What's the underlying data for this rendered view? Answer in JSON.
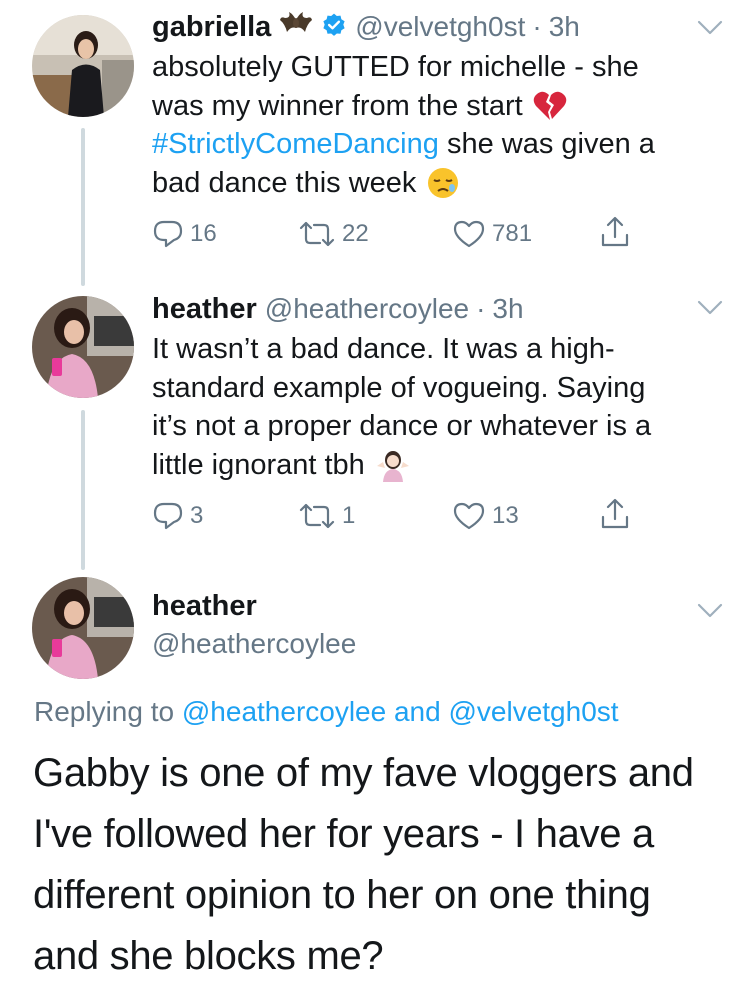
{
  "tweet1": {
    "name": "gabriella",
    "handle": "@velvetgh0st",
    "dot": "·",
    "time": "3h",
    "lines": [
      "absolutely GUTTED for michelle - she",
      "was my winner from the start",
      "#StrictlyComeDancing",
      " she was given a",
      "bad dance this week"
    ],
    "replies": "16",
    "retweets": "22",
    "likes": "781"
  },
  "tweet2": {
    "name": "heather",
    "handle": "@heathercoylee",
    "dot": "·",
    "time": "3h",
    "lines": [
      "It wasn’t a bad dance. It was a high-",
      "standard example of vogueing. Saying",
      "it’s not a proper dance or whatever is a",
      "little ignorant tbh"
    ],
    "replies": "3",
    "retweets": "1",
    "likes": "13"
  },
  "tweet3": {
    "name": "heather",
    "handle": "@heathercoylee",
    "replying_prefix": "Replying to",
    "replying_user1": "@heathercoylee",
    "replying_and": "and",
    "replying_user2": "@velvetgh0st",
    "lines": [
      "Gabby is one of my fave vloggers and",
      "I've followed her for years - I have a",
      "different opinion to her on one thing",
      "and she blocks me?"
    ]
  },
  "colors": {
    "text": "#14171a",
    "secondary": "#657786",
    "link": "#1da1f2",
    "thread_line": "#cfd9de",
    "verified": "#1da1f2"
  },
  "icons": [
    "bat-emoji",
    "verified-badge",
    "broken-heart-emoji",
    "sleepy-face-emoji",
    "woman-shrugging-emoji",
    "reply-icon",
    "retweet-icon",
    "like-icon",
    "share-icon",
    "chevron-down-icon"
  ]
}
